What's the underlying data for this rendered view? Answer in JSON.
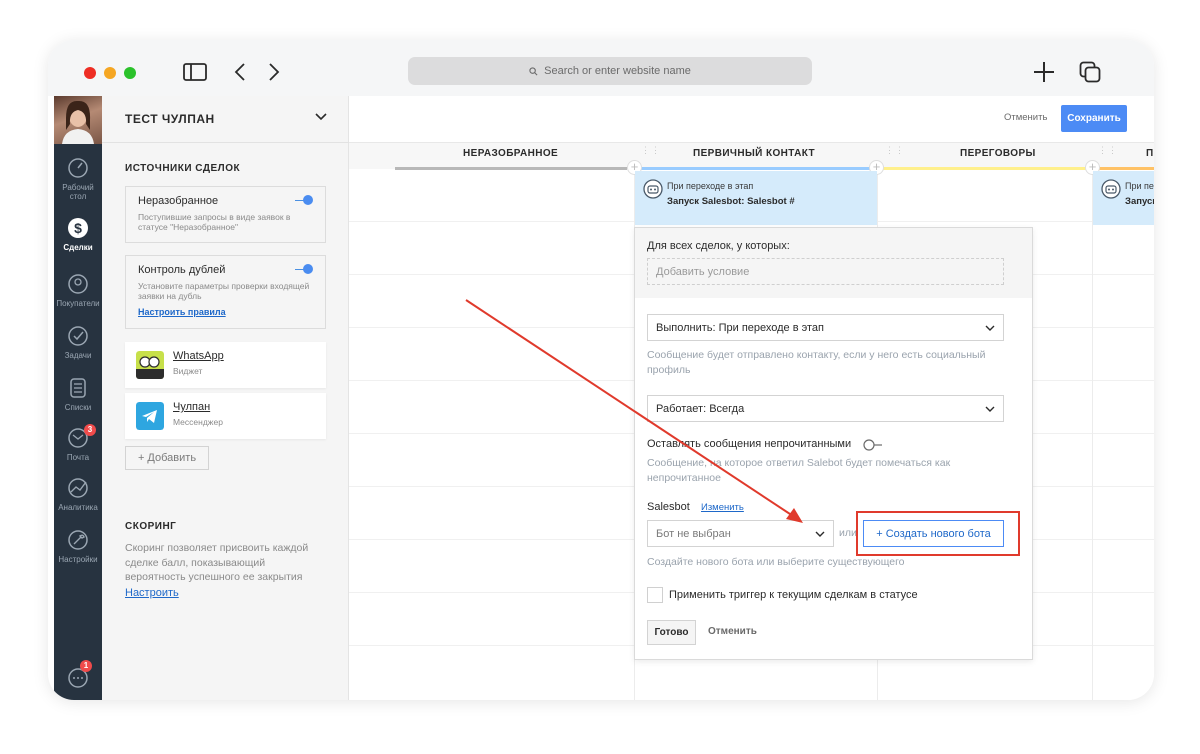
{
  "browser": {
    "address_placeholder": "Search or enter website name"
  },
  "nav": {
    "items": [
      {
        "label": "Рабочий стол",
        "icon": "dashboard-icon"
      },
      {
        "label": "Сделки",
        "icon": "deals-icon"
      },
      {
        "label": "Покупатели",
        "icon": "customers-icon"
      },
      {
        "label": "Задачи",
        "icon": "tasks-icon"
      },
      {
        "label": "Списки",
        "icon": "lists-icon"
      },
      {
        "label": "Почта",
        "icon": "mail-icon",
        "badge": "3"
      },
      {
        "label": "Аналитика",
        "icon": "analytics-icon"
      },
      {
        "label": "Настройки",
        "icon": "settings-icon"
      }
    ],
    "chat_badge": "1"
  },
  "panel": {
    "pipeline_title": "ТЕСТ ЧУЛПАН",
    "sources_title": "ИСТОЧНИКИ СДЕЛОК",
    "unsorted": {
      "title": "Неразобранное",
      "desc": "Поступившие запросы в виде заявок в статусе \"Неразобранное\""
    },
    "duplicates": {
      "title": "Контроль дублей",
      "desc": "Установите параметры проверки входящей заявки на дубль",
      "link": "Настроить правила"
    },
    "widgets": [
      {
        "title": "WhatsApp",
        "sub": "Виджет"
      },
      {
        "title": "Чулпан",
        "sub": "Мессенджер"
      }
    ],
    "add_label": "+ Добавить",
    "scoring_title": "СКОРИНГ",
    "scoring_desc": "Скоринг позволяет присвоить каждой сделке балл, показывающий вероятность успешного ее закрытия",
    "scoring_link": "Настроить"
  },
  "topbar": {
    "cancel": "Отменить",
    "save": "Сохранить"
  },
  "columns": [
    {
      "title": "НЕРАЗОБРАННОЕ",
      "color": "#b8b8b8"
    },
    {
      "title": "ПЕРВИЧНЫЙ КОНТАКТ",
      "color": "#99ccff"
    },
    {
      "title": "ПЕРЕГОВОРЫ",
      "color": "#fff08c"
    },
    {
      "title": "ПРИНИМА",
      "color": "#ffc266"
    }
  ],
  "triggers": [
    {
      "line1": "При переходе в этап",
      "line2": "Запуск Salesbot: Salesbot #"
    },
    {
      "line1": "При переходе в",
      "line2": "Запуск Salesbo"
    }
  ],
  "popup": {
    "for_all_label": "Для всех сделок, у которых:",
    "add_condition": "Добавить условие",
    "execute_select": "Выполнить: При переходе в этап",
    "execute_hint": "Сообщение будет отправлено контакту, если у него есть социальный профиль",
    "works_select": "Работает: Всегда",
    "unread_label": "Оставлять сообщения непрочитанными",
    "unread_hint": "Сообщение, на которое ответил Salebot будет помечаться как непрочитанное",
    "salesbot_label": "Salesbot",
    "salesbot_change": "Изменить",
    "bot_select": "Бот не выбран",
    "or": "или",
    "create_bot": "+ Создать нового бота",
    "create_hint": "Создайте нового бота или выберите существующего",
    "apply_label": "Применить триггер к текущим сделкам в статусе",
    "done": "Готово",
    "cancel": "Отменить"
  },
  "colors": {
    "accent": "#4c8bf5",
    "nav_bg": "#273340",
    "highlight": "#e03a2c",
    "trigger_bg": "#d5ebfb"
  }
}
